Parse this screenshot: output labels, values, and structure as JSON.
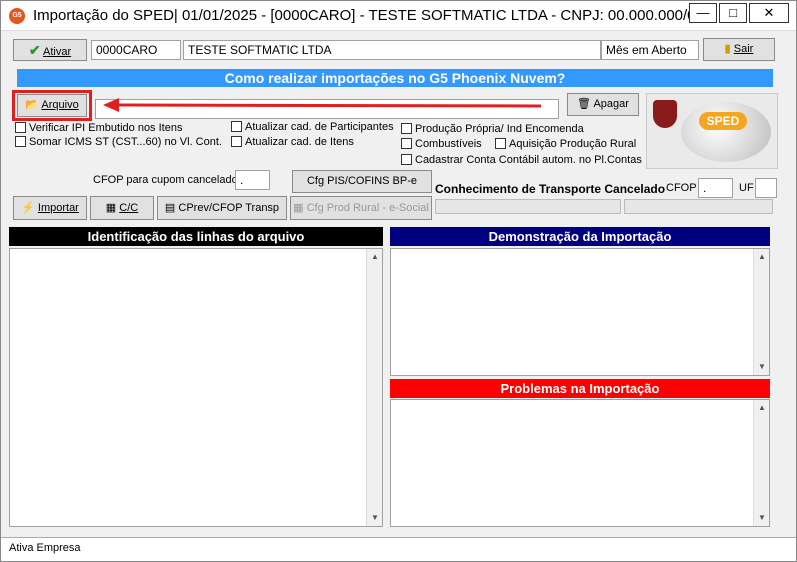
{
  "window": {
    "title": "Importação do SPED|  01/01/2025 - [0000CARO] - TESTE SOFTMATIC LTDA - CNPJ: 00.000.000/00...",
    "app_badge": "G5",
    "minimize": "—",
    "maximize": "□",
    "close": "✕"
  },
  "toolbar": {
    "ativar_label": "Ativar",
    "company_code": "0000CARO",
    "company_name": "TESTE SOFTMATIC LTDA",
    "period_status": "Mês em Aberto",
    "sair_label": "Sair"
  },
  "banner": "Como realizar importações no G5 Phoenix Nuvem?",
  "file": {
    "arquivo_label": "Arquivo",
    "path_value": "",
    "apagar_label": "Apagar"
  },
  "options": {
    "col1": [
      "Verificar IPI Embutido nos Itens",
      "Somar ICMS ST (CST...60) no Vl. Cont."
    ],
    "col2": [
      "Atualizar cad. de Participantes",
      "Atualizar cad. de Itens"
    ],
    "col3_a": "Produção Própria/ Ind Encomenda",
    "col3_b": "Combustíveis",
    "col3_c": "Aquisição Produção Rural",
    "col3_d": "Cadastrar Conta Contábil autom. no Pl.Contas"
  },
  "cfop": {
    "cupom_label": "CFOP para cupom cancelado",
    "cupom_value": ".",
    "cfg_pis_label": "Cfg PIS/COFINS BP-e",
    "cte_label": "Conhecimento de Transporte Cancelado",
    "cte_cfop_label": "CFOP",
    "cte_cfop_value": ".",
    "uf_label": "UF",
    "uf_value": ""
  },
  "actions": {
    "importar_label": "Importar",
    "cc_label": "C/C",
    "cprev_label": "CPrev/CFOP Transp",
    "cfg_rural_label": "Cfg Prod Rural - e-Social"
  },
  "panels": {
    "left_title": "Identificação das linhas do arquivo",
    "right_title": "Demonstração da Importação",
    "problems_title": "Problemas na Importação"
  },
  "logo_text": "SPED",
  "status": "Ativa Empresa",
  "colors": {
    "banner": "#3399ff",
    "left_head": "#000000",
    "right_head": "#000080",
    "problems_head": "#ff0000",
    "annotation": "#e02020"
  }
}
